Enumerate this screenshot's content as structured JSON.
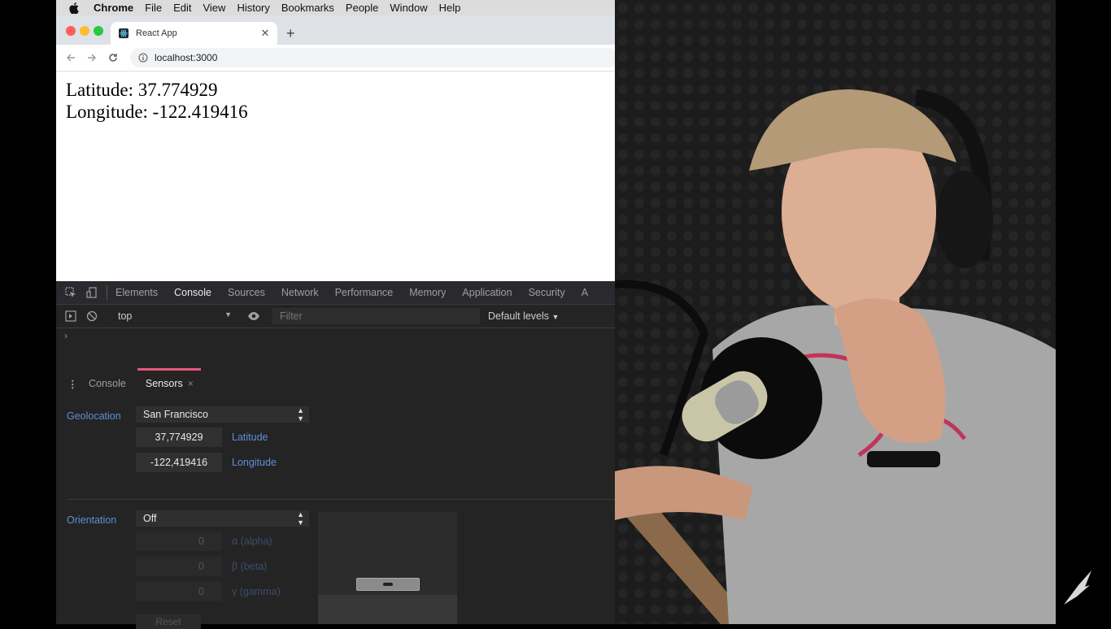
{
  "menubar": {
    "app": "Chrome",
    "items": [
      "File",
      "Edit",
      "View",
      "History",
      "Bookmarks",
      "People",
      "Window",
      "Help"
    ]
  },
  "browser": {
    "tab_title": "React App",
    "url": "localhost:3000"
  },
  "page": {
    "latitude_line": "Latitude: 37.774929",
    "longitude_line": "Longitude: -122.419416"
  },
  "devtools": {
    "tabs": [
      "Elements",
      "Console",
      "Sources",
      "Network",
      "Performance",
      "Memory",
      "Application",
      "Security",
      "A"
    ],
    "active_tab": "Console",
    "context": "top",
    "filter_placeholder": "Filter",
    "levels": "Default levels",
    "prompt": "›",
    "drawer": {
      "tabs": [
        "Console",
        "Sensors"
      ],
      "active": "Sensors",
      "close": "×"
    },
    "sensors": {
      "geolocation_label": "Geolocation",
      "geolocation_value": "San Francisco",
      "latitude_value": "37,774929",
      "latitude_label": "Latitude",
      "longitude_value": "-122,419416",
      "longitude_label": "Longitude",
      "orientation_label": "Orientation",
      "orientation_value": "Off",
      "alpha_value": "0",
      "alpha_label": "α (alpha)",
      "beta_value": "0",
      "beta_label": "β (beta)",
      "gamma_value": "0",
      "gamma_label": "γ (gamma)",
      "reset_label": "Reset"
    }
  },
  "colors": {
    "accent_tab_underline": "#e8567a",
    "link_blue": "#5f8fd6"
  }
}
